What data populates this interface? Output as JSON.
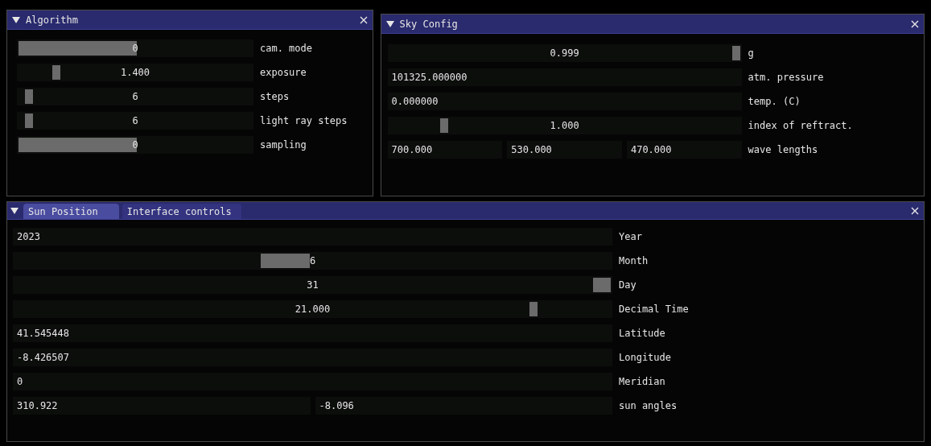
{
  "windows": [
    {
      "title": "Algorithm",
      "collapsed": false,
      "closable": true,
      "rows": [
        {
          "label": "cam. mode",
          "kind": "half_slider",
          "value": "0",
          "level": 0
        },
        {
          "label": "exposure",
          "kind": "slider",
          "value": "1.400",
          "level": 0.15
        },
        {
          "label": "steps",
          "kind": "slider",
          "value": "6",
          "level": 0.03
        },
        {
          "label": "light ray steps",
          "kind": "slider",
          "value": "6",
          "level": 0.03
        },
        {
          "label": "sampling",
          "kind": "half_slider",
          "value": "0",
          "level": 0
        }
      ]
    },
    {
      "title": "Sky Config",
      "collapsed": false,
      "closable": true,
      "rows": [
        {
          "label": "g",
          "kind": "slider",
          "value": "0.999",
          "level": 1
        },
        {
          "label": "atm. pressure",
          "kind": "input",
          "values": [
            "101325.000000"
          ]
        },
        {
          "label": "temp. (C)",
          "kind": "input",
          "values": [
            "0.000000"
          ]
        },
        {
          "label": "index of reftract.",
          "kind": "slider",
          "value": "1.000",
          "level": 0.15
        },
        {
          "label": "wave lengths",
          "kind": "input",
          "values": [
            "700.000",
            "530.000",
            "470.000"
          ]
        }
      ]
    },
    {
      "tabs": [
        {
          "label": "Sun Position",
          "selected": true
        },
        {
          "label": "Interface controls",
          "selected": false
        }
      ],
      "collapsed": false,
      "closable": true,
      "rows": [
        {
          "label": "Year",
          "kind": "input",
          "values": [
            "2023"
          ]
        },
        {
          "label": "Month",
          "kind": "step_slider",
          "value": "6",
          "level": 0.45
        },
        {
          "label": "Day",
          "kind": "narrow_step_slider",
          "value": "31",
          "level": 1
        },
        {
          "label": "Decimal Time",
          "kind": "slider",
          "value": "21.000",
          "level": 0.875
        },
        {
          "label": "Latitude",
          "kind": "input",
          "values": [
            "41.545448"
          ]
        },
        {
          "label": "Longitude",
          "kind": "input",
          "values": [
            "-8.426507"
          ]
        },
        {
          "label": "Meridian",
          "kind": "input",
          "values": [
            "0"
          ]
        },
        {
          "label": "sun angles",
          "kind": "input",
          "values": [
            "310.922",
            "-8.096"
          ]
        }
      ]
    }
  ]
}
